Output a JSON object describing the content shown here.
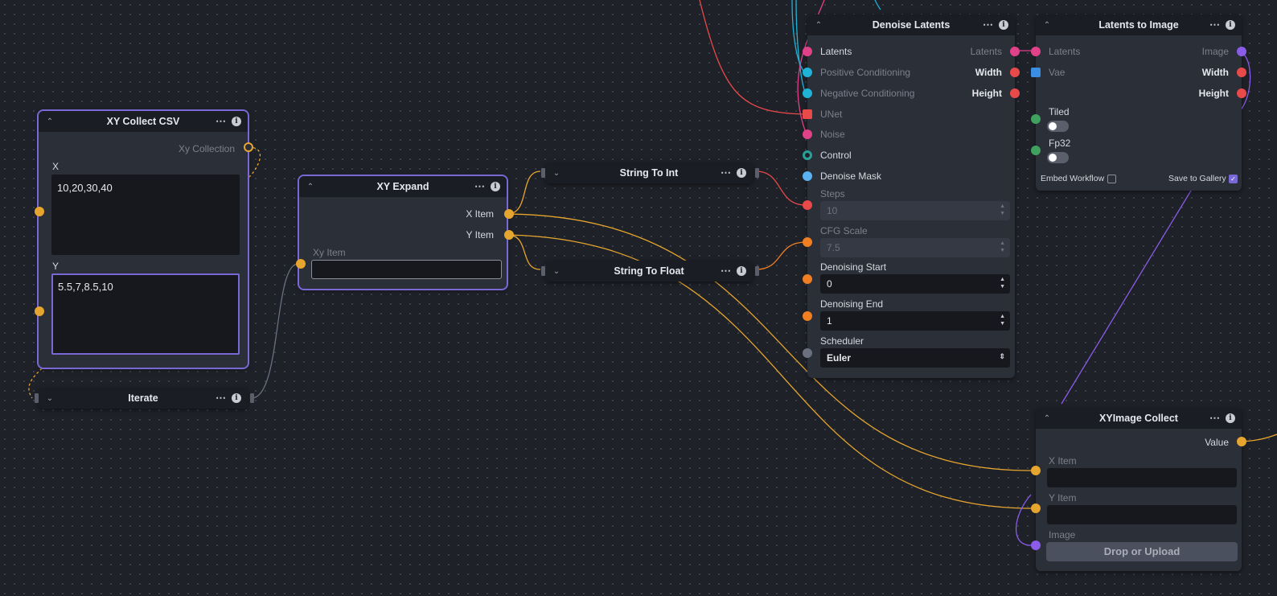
{
  "colors": {
    "canvas": "#1e2128",
    "node_body": "#2b2f38",
    "node_header": "#1a1d23",
    "selected_outline": "#7a68d6",
    "collection": "#e6a52e",
    "latents": "#e0428a",
    "conditioning": "#1fb3d6",
    "unet": "#e84a4a",
    "integer": "#e84a4a",
    "float": "#f07e23",
    "image": "#8a5ce8",
    "vae": "#3a8de0",
    "control": "#2aa198",
    "mask": "#5ab3f0",
    "scheduler": "#6b7080",
    "boolean": "#3fa060"
  },
  "nodes": {
    "xy_collect_csv": {
      "title": "XY Collect CSV",
      "output_label": "Xy Collection",
      "x_label": "X",
      "x_value": "10,20,30,40",
      "y_label": "Y",
      "y_value": "5.5,7,8.5,10"
    },
    "iterate": {
      "title": "Iterate"
    },
    "xy_expand": {
      "title": "XY Expand",
      "out_x": "X Item",
      "out_y": "Y Item",
      "in_label": "Xy Item",
      "in_value": ""
    },
    "string_to_int": {
      "title": "String To Int"
    },
    "string_to_float": {
      "title": "String To Float"
    },
    "denoise_latents": {
      "title": "Denoise Latents",
      "inputs": [
        "Latents",
        "Positive Conditioning",
        "Negative Conditioning",
        "UNet",
        "Noise",
        "Control",
        "Denoise Mask"
      ],
      "outputs": [
        "Latents",
        "Width",
        "Height"
      ],
      "steps_label": "Steps",
      "steps_value": "10",
      "cfg_label": "CFG Scale",
      "cfg_value": "7.5",
      "start_label": "Denoising Start",
      "start_value": "0",
      "end_label": "Denoising End",
      "end_value": "1",
      "scheduler_label": "Scheduler",
      "scheduler_value": "Euler"
    },
    "latents_to_image": {
      "title": "Latents to Image",
      "in_latents": "Latents",
      "in_vae": "Vae",
      "outputs": [
        "Image",
        "Width",
        "Height"
      ],
      "tiled_label": "Tiled",
      "tiled_on": false,
      "fp32_label": "Fp32",
      "fp32_on": false,
      "embed_label": "Embed Workflow",
      "embed_checked": false,
      "gallery_label": "Save to Gallery",
      "gallery_checked": true
    },
    "xyimage_collect": {
      "title": "XYImage Collect",
      "out_value": "Value",
      "x_label": "X Item",
      "x_value": "",
      "y_label": "Y Item",
      "y_value": "",
      "image_label": "Image",
      "upload_label": "Drop or Upload"
    }
  },
  "icons": {
    "collapse": "chevron-up-icon",
    "expand": "chevron-down-icon",
    "more": "more-icon",
    "info": "info-icon"
  }
}
